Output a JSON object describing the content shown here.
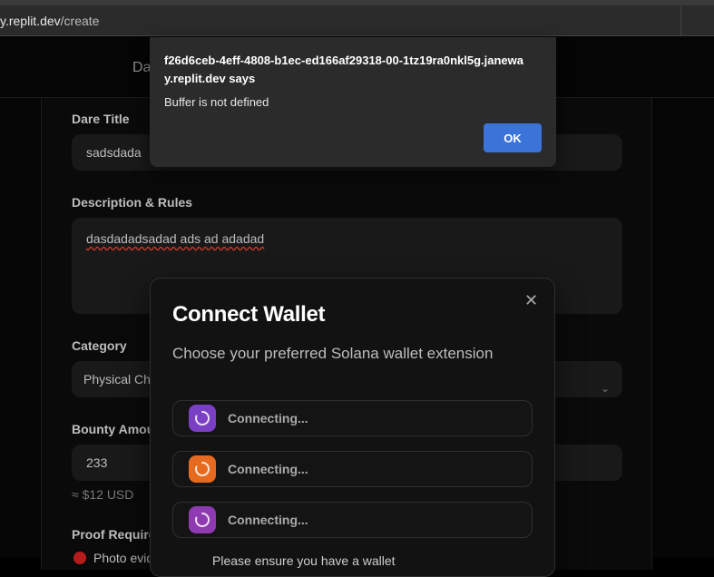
{
  "browser": {
    "url_host": "y.replit.dev",
    "url_path": "/create"
  },
  "app": {
    "nav_partial": "Da"
  },
  "form": {
    "dare_title_label": "Dare Title",
    "dare_title_value": "sadsdada",
    "description_label": "Description & Rules",
    "description_value": "dasdadadsadad ads ad adadad",
    "category_label": "Category",
    "category_value": "Physical Ch",
    "bounty_label": "Bounty Amou",
    "bounty_value": "233",
    "bounty_usd": "≈ $12 USD",
    "proof_label": "Proof Require",
    "proof_option": "Photo evid"
  },
  "alert": {
    "origin": "f26d6ceb-4eff-4808-b1ec-ed166af29318-00-1tz19ra0nkl5g.janeway.replit.dev says",
    "message": "Buffer is not defined",
    "ok_label": "OK"
  },
  "wallet_modal": {
    "title": "Connect Wallet",
    "subtitle": "Choose your preferred Solana wallet extension",
    "close": "✕",
    "options": [
      {
        "label": "Connecting...",
        "color": "#7b3fc4"
      },
      {
        "label": "Connecting...",
        "color": "#e66a1f"
      },
      {
        "label": "Connecting...",
        "color": "#8e3ab0"
      }
    ],
    "footnote": "Please ensure you have a wallet"
  }
}
